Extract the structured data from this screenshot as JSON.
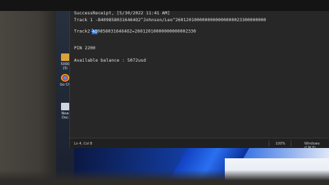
{
  "editor": {
    "lines": [
      "SuccessReceipt, [5/30/2022 11:41 AM]",
      "Track 1 -B4098580316464O2^Johnson/Leo^2601201000000000000000023300000000",
      "",
      "Track2-",
      "4O",
      "98580316464O2=26012010000000000002330",
      "",
      "",
      "PIN 2200",
      "",
      "",
      "Available balance : 5072usd"
    ]
  },
  "statusbar": {
    "position": "Ln 4, Col 8",
    "zoom": "100%",
    "line_ending": "Windows (CRLF)"
  },
  "desktop": {
    "icons": [
      {
        "label": "5000 (3)",
        "color": "#d9a23b"
      },
      {
        "label": "Go Ch",
        "color": "#e04034"
      },
      {
        "label": "New Doc",
        "color": "#cfd6e0"
      }
    ]
  }
}
